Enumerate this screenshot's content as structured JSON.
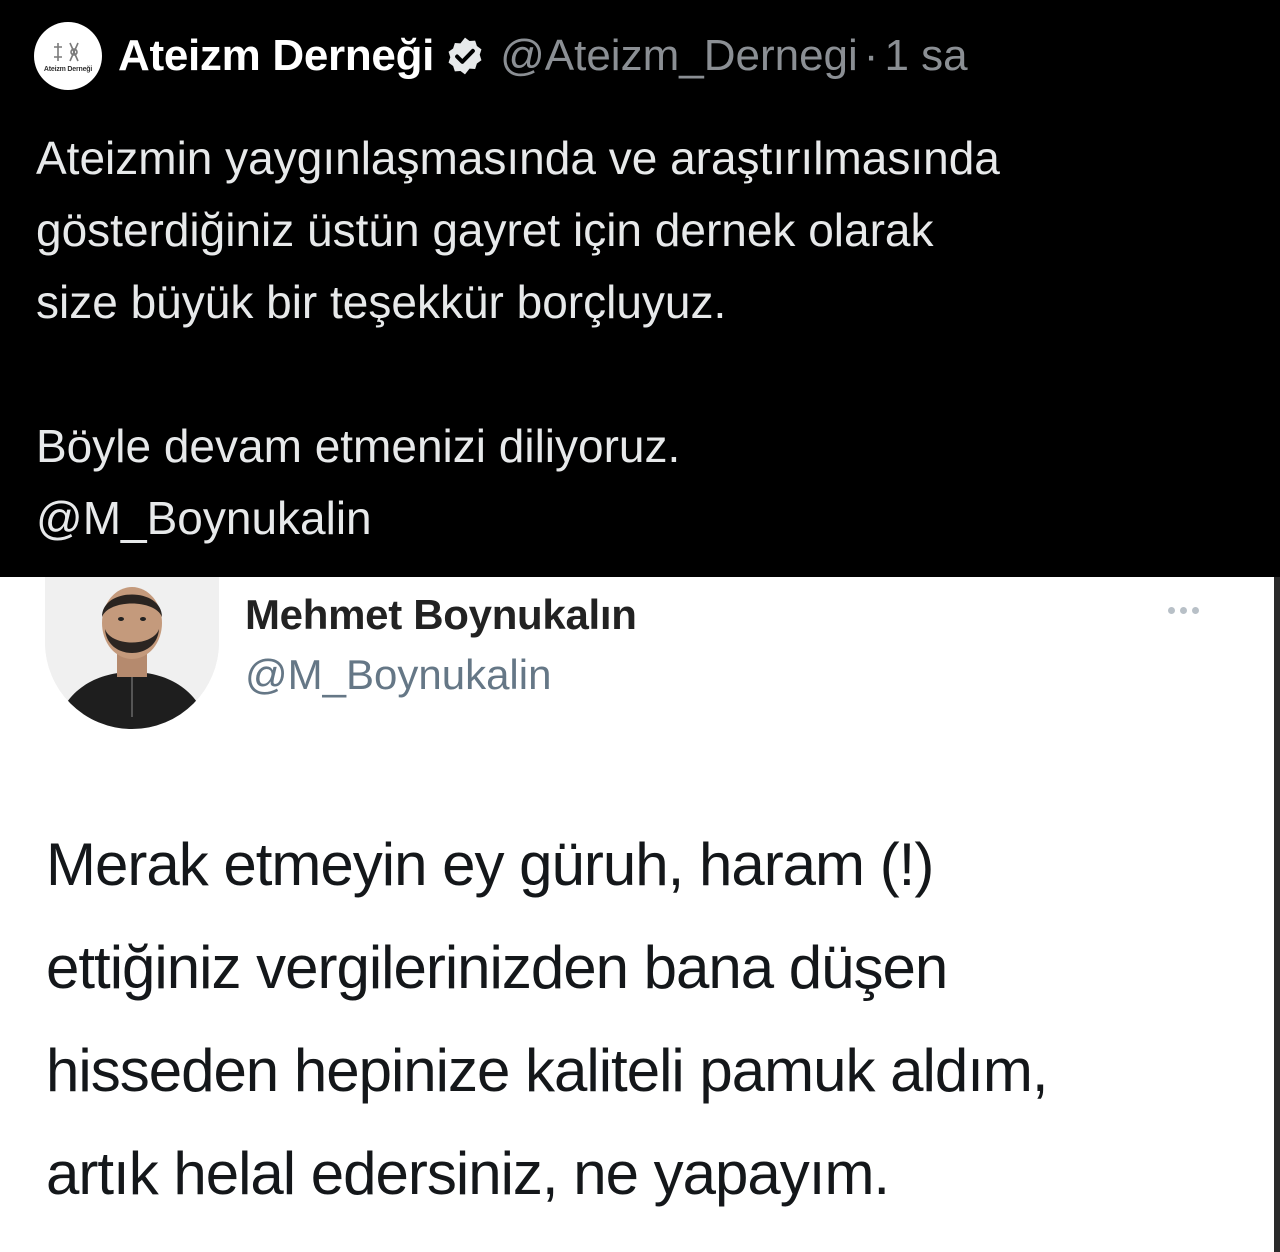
{
  "dark_tweet": {
    "author": {
      "name": "Ateizm Derneği",
      "handle": "@Ateizm_Dernegi",
      "separator": "·",
      "time": "1 sa",
      "avatar_text": "Ateizm Derneği",
      "verified": true
    },
    "body": {
      "line1": "Ateizmin yaygınlaşmasında ve araştırılmasında",
      "line2": "gösterdiğiniz üstün gayret için dernek olarak",
      "line3": "size büyük bir teşekkür borçluyuz.",
      "line4": "Böyle devam etmenizi diliyoruz.",
      "mention": "@M_Boynukalin"
    },
    "colors": {
      "background": "#000000",
      "text": "#e7e9ea",
      "secondary": "#8b8f94",
      "verified_badge": "#e7e9ea"
    }
  },
  "quoted_tweet": {
    "author": {
      "name": "Mehmet Boynukalın",
      "handle": "@M_Boynukalin"
    },
    "more_icon": "more-horizontal-icon",
    "body": {
      "line1": "Merak etmeyin ey güruh, haram (!)",
      "line2": "ettiğiniz vergilerinizden bana düşen",
      "line3": "hisseden hepinize kaliteli pamuk aldım,",
      "line4": "artık helal edersiniz, ne yapayım."
    },
    "colors": {
      "background": "#ffffff",
      "text": "#14171a",
      "handle": "#657786"
    }
  }
}
